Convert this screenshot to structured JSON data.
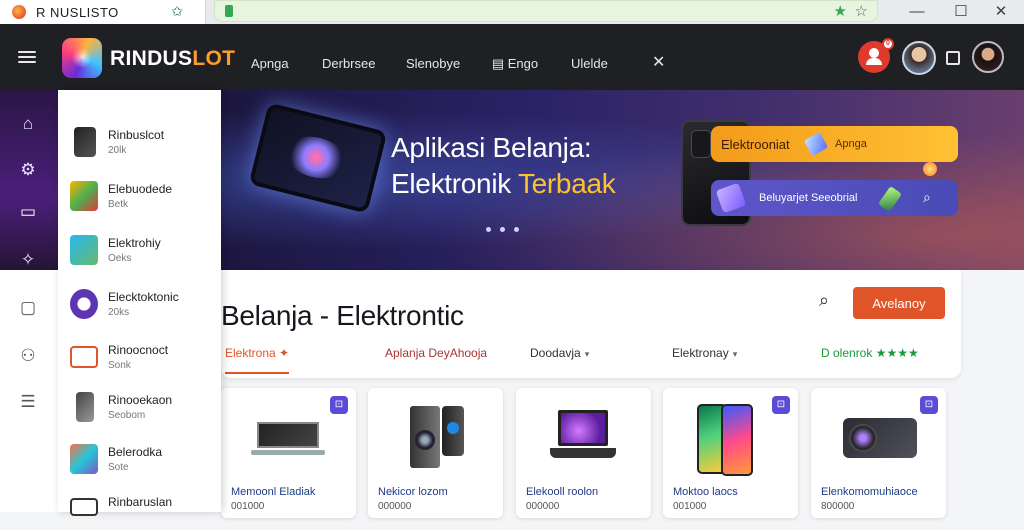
{
  "browser": {
    "tab_title": "R NUSLISTO",
    "tab_star": "✩"
  },
  "header": {
    "brand_main": "RINDUS",
    "brand_accent": "LOT",
    "nav": [
      "Apnga",
      "Derbrsee",
      "Slenobye",
      "Engo",
      "Ulelde"
    ],
    "nav_active_index": 3,
    "notif": "0",
    "close_glyph": "✕"
  },
  "sidebar_items": [
    {
      "name": "Rinbuslcot",
      "sub": "20lk"
    },
    {
      "name": "Elebuodede",
      "sub": "Betk"
    },
    {
      "name": "Elektrohiy",
      "sub": "Oeks"
    },
    {
      "name": "Elecktoktonic",
      "sub": "20ks"
    },
    {
      "name": "Rinoocnoct",
      "sub": "Sonk"
    },
    {
      "name": "Rinooekaon",
      "sub": "Seobom"
    },
    {
      "name": "Belerodka",
      "sub": "Sote"
    },
    {
      "name": "Rinbaruslan",
      "sub": ""
    }
  ],
  "banner": {
    "title_line1": "Aplikasi Belanja:",
    "title_line2_white": "Elektronik",
    "title_line2_yellow": "Terbaak",
    "pill1_label": "Elektrooniat",
    "pill1_action": "Apnga",
    "pill2_label": "Beluyarjet Seeobrial"
  },
  "main": {
    "title": "Belanja - Elektrontic",
    "cta": "Avelanoy",
    "filters": [
      {
        "label": "Elektrona",
        "suffix": "✦",
        "style": "active"
      },
      {
        "label": "Aplanja DeyAhooja",
        "suffix": "",
        "style": "plain"
      },
      {
        "label": "Doodavja",
        "suffix": "▾",
        "style": "plain"
      },
      {
        "label": "Elektronay",
        "suffix": "▾",
        "style": "plain"
      },
      {
        "label": "D olenrok ★★★★",
        "suffix": "",
        "style": "green"
      }
    ]
  },
  "products": [
    {
      "name": "Memoonl Eladiak",
      "price": "001000",
      "badge": "⊡"
    },
    {
      "name": "Nekicor lozom",
      "price": "000000",
      "badge": ""
    },
    {
      "name": "Elekooll roolon",
      "price": "000000",
      "badge": ""
    },
    {
      "name": "Moktoo laocs",
      "price": "001000",
      "badge": "⊡"
    },
    {
      "name": "Elenkomomuhiaoce",
      "price": "800000",
      "badge": "⊡"
    }
  ]
}
